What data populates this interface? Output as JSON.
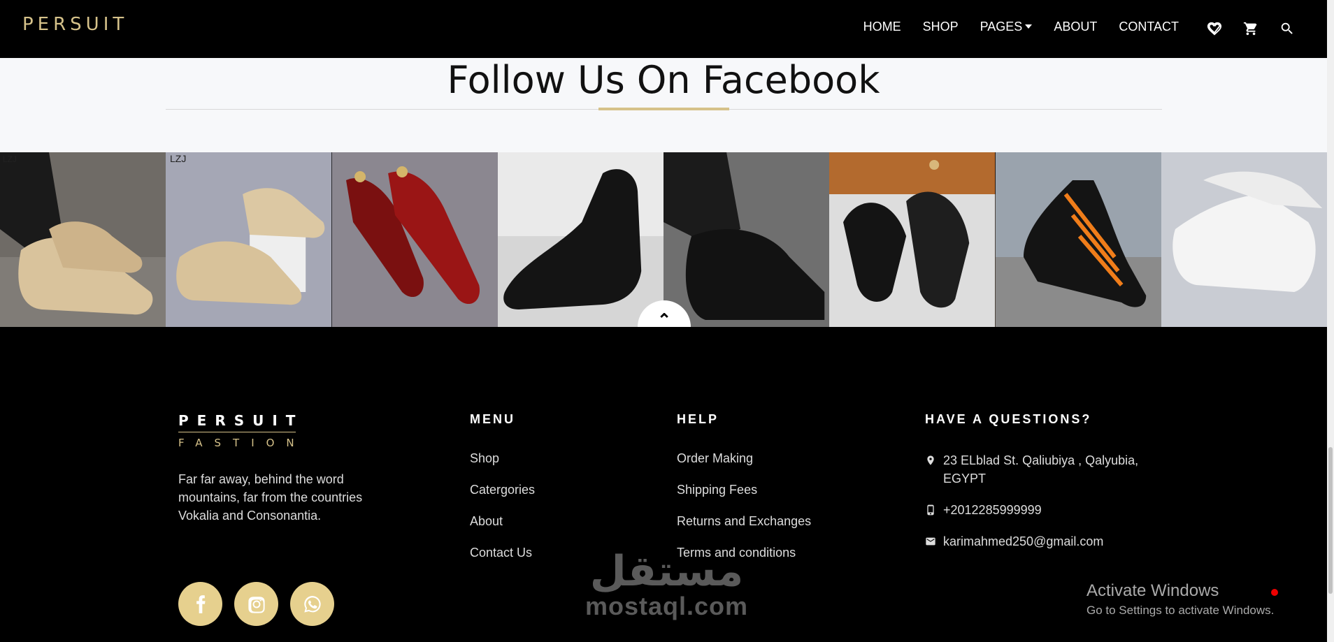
{
  "header": {
    "logo": "PERSUIT",
    "nav": [
      "HOME",
      "SHOP",
      "PAGES",
      "ABOUT",
      "CONTACT"
    ],
    "icons": [
      "heart-icon",
      "cart-icon",
      "search-icon"
    ]
  },
  "follow": {
    "title": "Follow Us On Facebook"
  },
  "gallery": {
    "tile_labels": [
      "LZJ",
      "LZJ"
    ]
  },
  "footer": {
    "brand_top": "PERSUIT",
    "brand_bottom": "FASTION",
    "about": "Far far away, behind the word mountains, far from the countries Vokalia and Consonantia.",
    "menu_title": "MENU",
    "menu": [
      "Shop",
      "Catergories",
      "About",
      "Contact Us"
    ],
    "help_title": "HELP",
    "help": [
      "Order Making",
      "Shipping Fees",
      "Returns and Exchanges",
      "Terms and conditions"
    ],
    "contact_title": "HAVE A QUESTIONS?",
    "address": "23 ELblad St. Qaliubiya , Qalyubia, EGYPT",
    "phone": "+2012285999999",
    "email": "karimahmed250@gmail.com",
    "socials": [
      "facebook-icon",
      "instagram-icon",
      "whatsapp-icon"
    ]
  },
  "overlay": {
    "watermark_ar": "مستقل",
    "watermark_en": "mostaql.com",
    "activate_title": "Activate Windows",
    "activate_sub": "Go to Settings to activate Windows."
  },
  "colors": {
    "gold": "#d6c28a",
    "black": "#000000"
  }
}
